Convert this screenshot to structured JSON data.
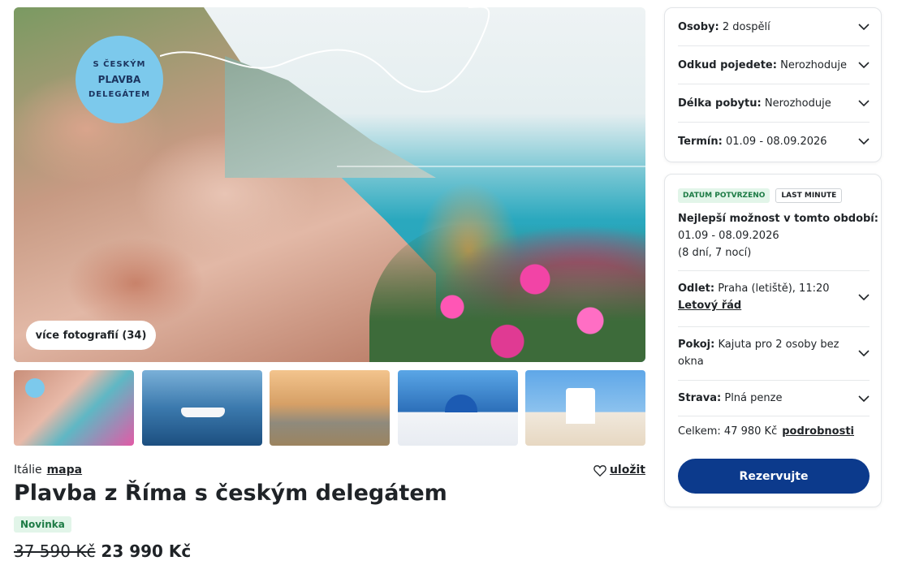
{
  "hero": {
    "stamp_ring_top": "S ČESKÝM",
    "stamp_center": "PLAVBA",
    "stamp_ring_bottom": "DELEGÁTEM",
    "more_photos_label": "více fotografií (34)"
  },
  "thumbnails": [
    "amalfi-coast",
    "cruise-ship",
    "rome-rooftops",
    "santorini-domes",
    "santorini-church"
  ],
  "info": {
    "country": "Itálie",
    "map_link": "mapa",
    "save_label": "uložit",
    "title": "Plavba z Říma s českým delegátem",
    "badge": "Novinka",
    "price_old": "37 590 Kč",
    "price_new": "23 990 Kč"
  },
  "filters": [
    {
      "label": "Osoby:",
      "value": "2 dospělí"
    },
    {
      "label": "Odkud pojedete:",
      "value": "Nerozhoduje"
    },
    {
      "label": "Délka pobytu:",
      "value": "Nerozhoduje"
    },
    {
      "label": "Termín:",
      "value": "01.09 - 08.09.2026"
    }
  ],
  "offer": {
    "tag_confirmed": "DATUM POTVRZENO",
    "tag_last_minute": "LAST MINUTE",
    "best_title": "Nejlepší možnost v tomto období:",
    "best_dates": "01.09 - 08.09.2026",
    "best_length": "(8 dní, 7 nocí)",
    "departure_label": "Odlet:",
    "departure_value": "Praha (letiště), 11:20",
    "timetable_link": "Letový řád",
    "room_label": "Pokoj:",
    "room_value": "Kajuta pro 2 osoby bez okna",
    "board_label": "Strava:",
    "board_value": "Plná penze",
    "total_label": "Celkem: 47 980 Kč",
    "details_link": "podrobnosti",
    "reserve_label": "Rezervujte"
  },
  "colors": {
    "primary_button": "#0c3a8c",
    "badge_green_bg": "#e2f5e9",
    "badge_green_text": "#1d7b45"
  }
}
